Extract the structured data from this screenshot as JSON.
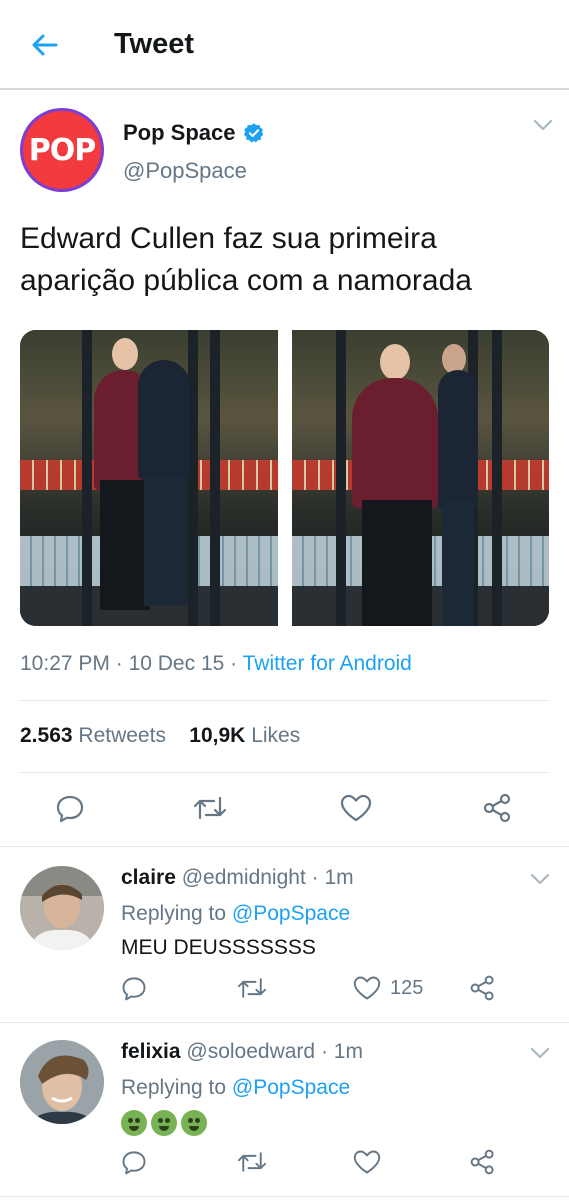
{
  "header": {
    "title": "Tweet"
  },
  "tweet": {
    "author_name": "Pop Space",
    "author_handle": "@PopSpace",
    "avatar_text": "POP",
    "verified": true,
    "text": "Edward Cullen faz sua primeira aparição pública com a namorada",
    "time": "10:27 PM",
    "sep1": "·",
    "date": "10 Dec 15",
    "sep2": "·",
    "source": "Twitter for Android",
    "retweets_count": "2.563",
    "retweets_label": "Retweets",
    "likes_count": "10,9K",
    "likes_label": "Likes"
  },
  "replies": [
    {
      "name": "claire",
      "handle": "@edmidnight",
      "sep": "·",
      "time": "1m",
      "replying_prefix": "Replying to",
      "replying_to": "@PopSpace",
      "text": "MEU DEUSSSSSSS",
      "like_count": "125"
    },
    {
      "name": "felixia",
      "handle": "@soloedward",
      "sep": "·",
      "time": "1m",
      "replying_prefix": "Replying to",
      "replying_to": "@PopSpace",
      "emoji_count": 3
    }
  ],
  "colors": {
    "accent": "#1da1f2",
    "text": "#14171a",
    "muted": "#657786",
    "divider": "#e1e8ed",
    "avatar_red": "#f23a3f",
    "avatar_ring": "#7b3fd1"
  },
  "icons": {
    "back": "arrow-left-icon",
    "verified": "verified-badge-icon",
    "caret": "chevron-down-icon",
    "reply": "reply-icon",
    "retweet": "retweet-icon",
    "like": "heart-icon",
    "share": "share-icon"
  }
}
